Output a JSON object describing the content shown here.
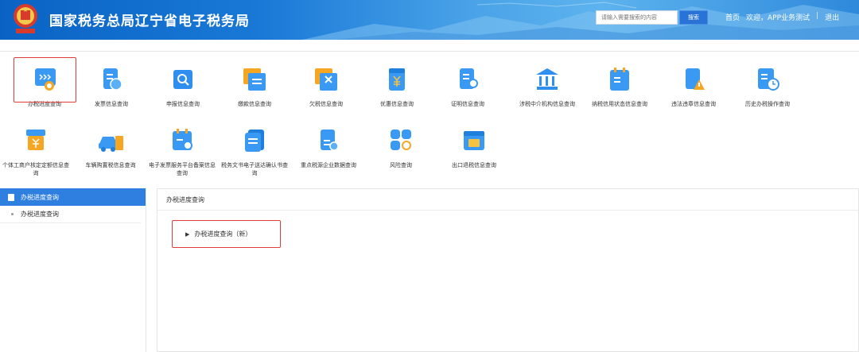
{
  "header": {
    "title": "国家税务总局辽宁省电子税务局",
    "emblem_text": "中国税务",
    "search_placeholder": "请输入需要搜索的内容",
    "search_button": "搜索",
    "links": [
      "首页",
      "欢迎，APP业务测试",
      "退出"
    ],
    "separator": "|",
    "bg_color": "#1978d6"
  },
  "icons_row1": [
    {
      "label": "办税进度查询",
      "icon": "progress-query-icon",
      "color": "#2e8ff0"
    },
    {
      "label": "发票信息查询",
      "icon": "invoice-query-icon",
      "color": "#2e8ff0"
    },
    {
      "label": "申报信息查询",
      "icon": "declaration-query-icon",
      "color": "#2e8ff0"
    },
    {
      "label": "缴款信息查询",
      "icon": "payment-query-icon",
      "color": "#f5a623"
    },
    {
      "label": "欠税信息查询",
      "icon": "tax-arrears-query-icon",
      "color": "#f5a623"
    },
    {
      "label": "优惠信息查询",
      "icon": "preferential-query-icon",
      "color": "#2e8ff0"
    },
    {
      "label": "证明信息查询",
      "icon": "certificate-query-icon",
      "color": "#2e8ff0"
    },
    {
      "label": "涉税中介机构信息查询",
      "icon": "tax-agency-query-icon",
      "color": "#2e8ff0"
    },
    {
      "label": "纳税信用状态信息查询",
      "icon": "credit-status-query-icon",
      "color": "#2e8ff0"
    },
    {
      "label": "违法违章信息查询",
      "icon": "violation-query-icon",
      "color": "#2e8ff0"
    },
    {
      "label": "历史办税操作查询",
      "icon": "history-query-icon",
      "color": "#2e8ff0"
    }
  ],
  "icons_row2": [
    {
      "label": "个体工商户核定定额信息查询",
      "icon": "individual-business-icon",
      "color": "#2e8ff0"
    },
    {
      "label": "车辆购置税信息查询",
      "icon": "vehicle-tax-icon",
      "color": "#2e8ff0"
    },
    {
      "label": "电子发票服务平台备案信息查询",
      "icon": "e-invoice-record-icon",
      "color": "#2e8ff0"
    },
    {
      "label": "税务文书电子送达确认书查询",
      "icon": "tax-document-icon",
      "color": "#2e8ff0"
    },
    {
      "label": "重点税源企业数据查询",
      "icon": "key-tax-source-icon",
      "color": "#2e8ff0"
    },
    {
      "label": "风险查询",
      "icon": "risk-query-icon",
      "color": "#2e8ff0"
    },
    {
      "label": "出口退税信息查询",
      "icon": "export-rebate-icon",
      "color": "#2e8ff0"
    }
  ],
  "sidebar": {
    "title": "办税进度查询",
    "items": [
      "办税进度查询"
    ]
  },
  "main": {
    "title": "办税进度查询",
    "link_arrow": "▶",
    "link_label": "办税进度查询（新）"
  }
}
